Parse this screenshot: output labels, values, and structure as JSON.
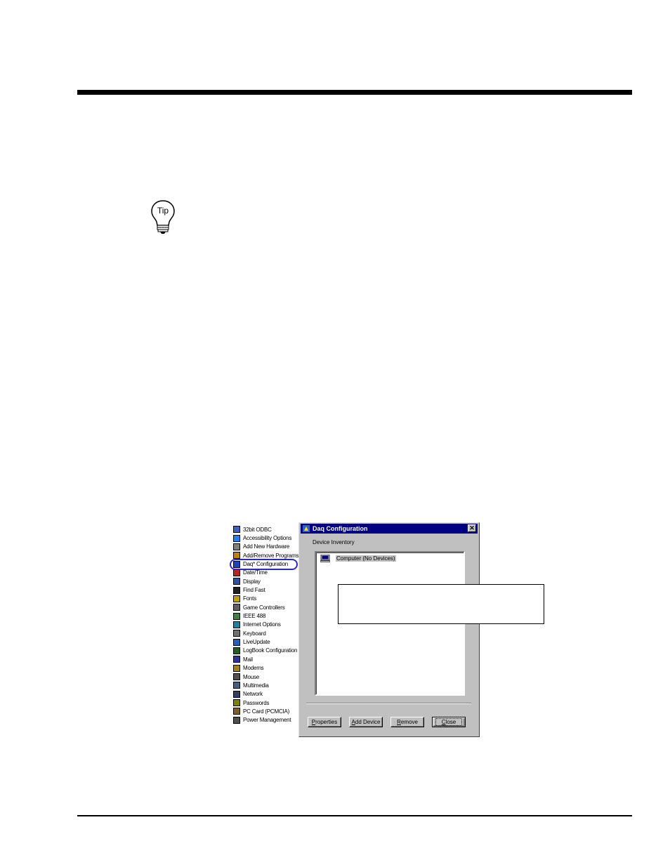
{
  "control_panel": {
    "items": [
      "32bit ODBC",
      "Accessibility Options",
      "Add New Hardware",
      "Add/Remove Programs",
      "Daq* Configuration",
      "Date/Time",
      "Display",
      "Find Fast",
      "Fonts",
      "Game Controllers",
      "IEEE 488",
      "Internet Options",
      "Keyboard",
      "LiveUpdate",
      "LogBook Configuration",
      "Mail",
      "Modems",
      "Mouse",
      "Multimedia",
      "Network",
      "Passwords",
      "PC Card (PCMCIA)",
      "Power Management"
    ],
    "highlighted_index": 4
  },
  "dialog": {
    "title": "Daq Configuration",
    "close_glyph": "✕",
    "inventory_label": "Device Inventory",
    "tree_item": "Computer (No Devices)",
    "buttons": {
      "properties_mnemonic": "P",
      "properties_rest": "roperties",
      "add_mnemonic": "A",
      "add_rest": "dd Device",
      "remove_mnemonic": "R",
      "remove_rest": "emove",
      "close_mnemonic": "C",
      "close_rest": "lose"
    }
  },
  "tip": {
    "icon_text": "Tip"
  },
  "colors": {
    "titlebar": "#000080",
    "dialog_face": "#c0c0c0",
    "highlight_oval": "#2a2ac8"
  }
}
